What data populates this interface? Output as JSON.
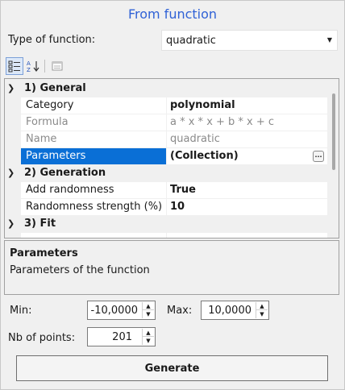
{
  "title": "From function",
  "type_of_function": {
    "label": "Type of function:",
    "value": "quadratic"
  },
  "toolbar": {
    "buttons": [
      {
        "name": "categorized-view",
        "icon": "categorized-icon",
        "active": true
      },
      {
        "name": "alphabetical-view",
        "icon": "sort-az-icon",
        "active": false
      },
      {
        "name": "property-pages",
        "icon": "property-pages-icon",
        "active": false
      }
    ]
  },
  "property_grid": {
    "categories": [
      {
        "label": "1) General",
        "properties": [
          {
            "name": "Category",
            "value": "polynomial",
            "readonly": false,
            "bold": true
          },
          {
            "name": "Formula",
            "value": "a * x * x + b * x + c",
            "readonly": true,
            "bold": false
          },
          {
            "name": "Name",
            "value": "quadratic",
            "readonly": true,
            "bold": false
          },
          {
            "name": "Parameters",
            "value": "(Collection)",
            "readonly": false,
            "bold": true,
            "selected": true,
            "ellipsis": "..."
          }
        ]
      },
      {
        "label": "2) Generation",
        "properties": [
          {
            "name": "Add randomness",
            "value": "True",
            "readonly": false,
            "bold": true
          },
          {
            "name": "Randomness strength (%)",
            "value": "10",
            "readonly": false,
            "bold": true
          }
        ]
      },
      {
        "label": "3) Fit",
        "properties": []
      }
    ]
  },
  "description": {
    "title": "Parameters",
    "text": "Parameters of the function"
  },
  "range": {
    "min_label": "Min:",
    "min_value": "-10,0000",
    "max_label": "Max:",
    "max_value": "10,0000"
  },
  "points": {
    "label": "Nb of points:",
    "value": "201"
  },
  "generate_label": "Generate",
  "colors": {
    "title": "#3062d6",
    "selection": "#0a6fd6",
    "readonly_text": "#8a8a8a"
  }
}
